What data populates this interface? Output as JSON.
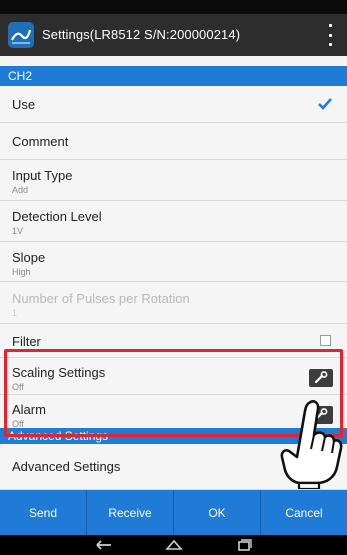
{
  "app": {
    "title": "Settings(LR8512 S/N:200000214)",
    "icon": "app-logo-icon",
    "menu_icon": "overflow-menu-icon"
  },
  "sections": {
    "ch2": "CH2",
    "advanced": "Advanced Settings"
  },
  "rows": {
    "use": {
      "label": "Use",
      "checked": true
    },
    "comment": {
      "label": "Comment"
    },
    "input_type": {
      "label": "Input Type",
      "value": "Add"
    },
    "detection_level": {
      "label": "Detection Level",
      "value": "1V"
    },
    "slope": {
      "label": "Slope",
      "value": "High"
    },
    "pulses": {
      "label": "Number of Pulses per Rotation",
      "value": "1",
      "enabled": false
    },
    "filter": {
      "label": "Filter",
      "checked": false
    },
    "scaling": {
      "label": "Scaling Settings",
      "value": "Off"
    },
    "alarm": {
      "label": "Alarm",
      "value": "Off"
    },
    "advanced": {
      "label": "Advanced Settings"
    }
  },
  "buttons": {
    "send": "Send",
    "receive": "Receive",
    "ok": "OK",
    "cancel": "Cancel"
  },
  "nav": [
    "back-icon",
    "home-icon",
    "recent-apps-icon"
  ],
  "colors": {
    "accent": "#1f7bd6",
    "highlight": "#e1242e",
    "topbar": "#2d2d2d"
  }
}
